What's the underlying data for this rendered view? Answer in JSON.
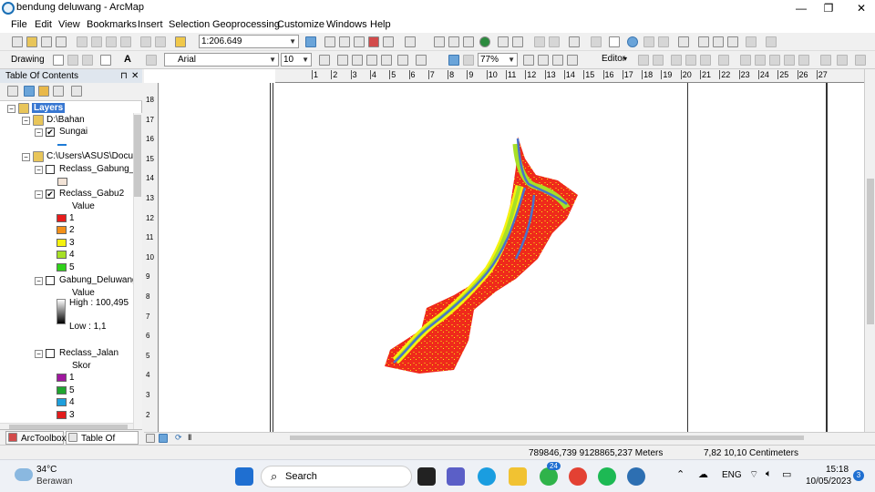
{
  "window": {
    "title": "bendung deluwang - ArcMap",
    "min": "—",
    "max": "❐",
    "close": "✕"
  },
  "menu": [
    "File",
    "Edit",
    "View",
    "Bookmarks",
    "Insert",
    "Selection",
    "Geoprocessing",
    "Customize",
    "Windows",
    "Help"
  ],
  "toolbar": {
    "scale": "1:206.649",
    "drawing": "Drawing",
    "font": "Arial",
    "font_size": "10",
    "zoom": "77%",
    "editor": "Editor"
  },
  "toc": {
    "title": "Table Of Contents",
    "pin": "⊓",
    "close": "✕",
    "root": "Layers",
    "groups": [
      {
        "name": "D:\\Bahan",
        "layers": [
          {
            "name": "Sungai",
            "checked": true
          }
        ]
      },
      {
        "name": "C:\\Users\\ASUS\\Docum",
        "layers": [
          {
            "name": "Reclass_Gabung_P",
            "checked": false
          },
          {
            "name": "Reclass_Gabu2",
            "checked": true,
            "field": "Value",
            "classes": [
              {
                "label": "1",
                "color": "#e81b1b"
              },
              {
                "label": "2",
                "color": "#f39019"
              },
              {
                "label": "3",
                "color": "#f5f20e"
              },
              {
                "label": "4",
                "color": "#a7e026"
              },
              {
                "label": "5",
                "color": "#2fd11a"
              }
            ]
          },
          {
            "name": "Gabung_Deluwang",
            "checked": false,
            "field": "Value",
            "high": "High : 100,495",
            "low": "Low : 1,1"
          },
          {
            "name": "Reclass_Jalan",
            "checked": false,
            "field": "Skor",
            "classes": [
              {
                "label": "1",
                "color": "#a0179f"
              },
              {
                "label": "5",
                "color": "#1fa52f"
              },
              {
                "label": "4",
                "color": "#1e9fdc"
              },
              {
                "label": "3",
                "color": "#e21c1c"
              }
            ]
          }
        ]
      }
    ],
    "tabs": [
      "ArcToolbox",
      "Table Of Con..."
    ]
  },
  "hruler_labels": [
    "1",
    "2",
    "3",
    "4",
    "5",
    "6",
    "7",
    "8",
    "9",
    "10",
    "11",
    "12",
    "13",
    "14",
    "15",
    "16",
    "17",
    "18",
    "19",
    "20",
    "21",
    "22",
    "23",
    "24",
    "25",
    "26",
    "27"
  ],
  "vruler_labels": [
    "18",
    "17",
    "16",
    "15",
    "14",
    "13",
    "12",
    "11",
    "10",
    "9",
    "8",
    "7",
    "6",
    "5",
    "4",
    "3",
    "2"
  ],
  "status": {
    "map_coords": "789846,739  9128865,237 Meters",
    "page_coords": "7,82  10,10 Centimeters"
  },
  "taskbar": {
    "weather_temp": "34°C",
    "weather_desc": "Berawan",
    "search": "Search",
    "lang": "ENG",
    "time": "15:18",
    "date": "10/05/2023",
    "notif_count": "3",
    "badge_24": "24"
  }
}
